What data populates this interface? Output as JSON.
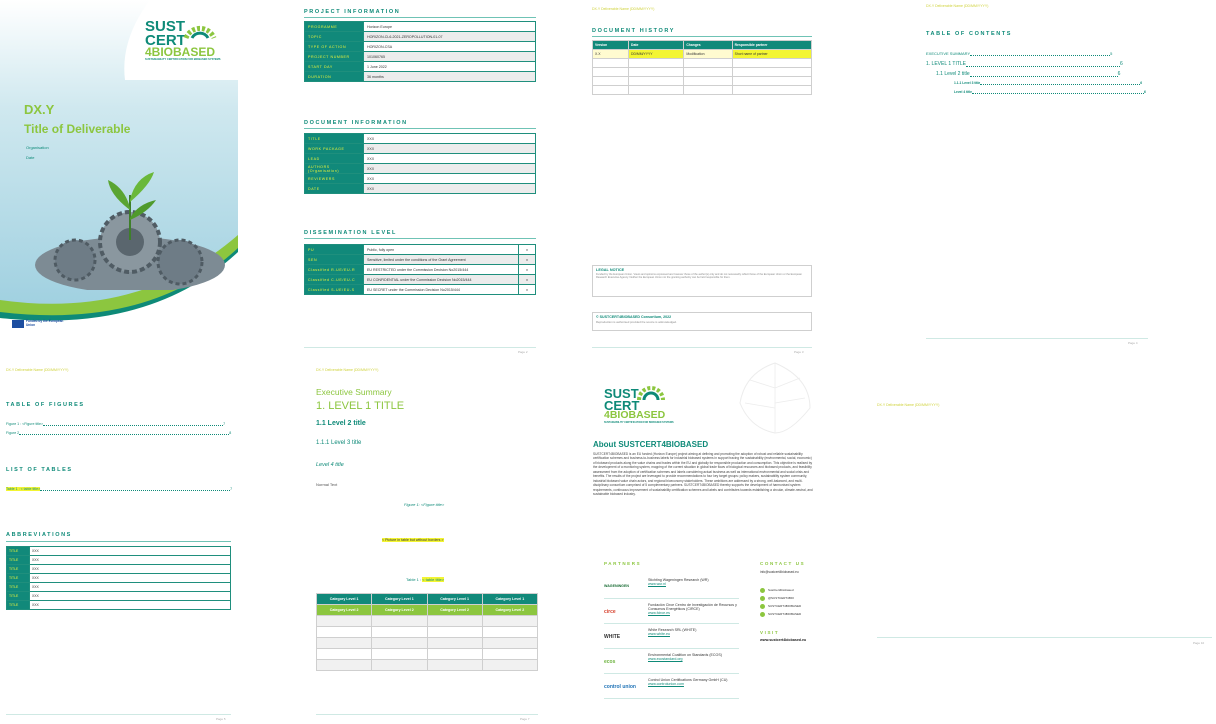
{
  "cover": {
    "brand_line1": "SUST",
    "brand_line2": "CERT",
    "brand_line3": "4BIOBASED",
    "brand_sub": "SUSTAINABILITY CERTIFICATION FOR BIOBASED SYSTEMS",
    "dx": "DX.Y",
    "title": "Title of Deliverable",
    "organisation": "Organisation",
    "date": "Date",
    "eu_funded": "Funded by the European Union"
  },
  "project_info": {
    "heading": "PROJECT INFORMATION",
    "rows": [
      {
        "k": "PROGRAMME",
        "v": "Horizon Europe"
      },
      {
        "k": "TOPIC",
        "v": "HORIZON-CL6-2021-ZEROPOLLUTION-01-07"
      },
      {
        "k": "TYPE OF ACTION",
        "v": "HORIZON-CSA"
      },
      {
        "k": "PROJECT NUMBER",
        "v": "101060765"
      },
      {
        "k": "START DAY",
        "v": "1 June 2022"
      },
      {
        "k": "DURATION",
        "v": "36 months"
      }
    ]
  },
  "doc_info": {
    "heading": "DOCUMENT INFORMATION",
    "rows": [
      {
        "k": "TITLE",
        "v": "XXX"
      },
      {
        "k": "WORK PACKAGE",
        "v": "XXX"
      },
      {
        "k": "LEAD",
        "v": "XXX"
      },
      {
        "k": "AUTHORS (Organisation)",
        "v": "XXX"
      },
      {
        "k": "REVIEWERS",
        "v": "XXX"
      },
      {
        "k": "DATE",
        "v": "XXX"
      }
    ]
  },
  "dissemination": {
    "heading": "DISSEMINATION LEVEL",
    "rows": [
      {
        "k": "PU",
        "v": "Public, fully open",
        "x": "x"
      },
      {
        "k": "SEN",
        "v": "Sensitive, limited under the conditions of the Grant Agreement",
        "x": "x"
      },
      {
        "k": "Classified R-UE/EU-R",
        "v": "EU RESTRICTED under the Commission Decision No2015/444",
        "x": "x"
      },
      {
        "k": "Classified C-UE/EU-C",
        "v": "EU CONFIDENTIAL under the Commission Decision No2015/444",
        "x": "x"
      },
      {
        "k": "Classified S-UE/EU-S",
        "v": "EU SECRET under the Commission Decision No2015/444",
        "x": "x"
      }
    ]
  },
  "running_header": "DX.Y Deliverable Name (DD/MM/YYYY)",
  "history": {
    "heading": "DOCUMENT HISTORY",
    "cols": [
      "Version",
      "Date",
      "Changes",
      "Responsible partner"
    ],
    "first_row": [
      "X.X",
      "DD/MM/YYYY",
      "Modification",
      "Short name of partner"
    ],
    "legal_title": "LEGAL NOTICE",
    "legal_text": "Funded by the European Union. Views and opinions expressed are however those of the author(s) only and do not necessarily reflect those of the European Union or the European Research Executive Agency. Neither the European Union nor the granting authority can be held responsible for them.",
    "copyright_title": "© SUSTCERT4BIOBASED Consortium, 2022",
    "copyright_text": "Reproduction is authorised provided the source is acknowledged."
  },
  "toc": {
    "heading": "TABLE OF CONTENTS",
    "entries": [
      {
        "t": "EXECUTIVE SUMMARY",
        "p": "5"
      },
      {
        "t": "1.    LEVEL 1 TITLE",
        "p": "6"
      },
      {
        "t": "1.1    Level 2 title",
        "p": "6"
      },
      {
        "t": "1.1.1  Level 3 title",
        "p": "6"
      },
      {
        "t": "Level 4 title",
        "p": "6"
      }
    ]
  },
  "figures": {
    "heading": "TABLE OF FIGURES",
    "items": [
      {
        "t": "Figure 1 : <Figure title>",
        "p": "7"
      },
      {
        "t": "Figure 2",
        "p": "8"
      }
    ],
    "tables_heading": "LIST OF TABLES",
    "table_item": "Table 1 : < table title>",
    "table_page": "7",
    "abbr_heading": "ABBREVIATIONS",
    "abbr_key": "TITLE",
    "abbr_val": "XXX"
  },
  "exec": {
    "summary": "Executive Summary",
    "level1": "1.   LEVEL 1 TITLE",
    "level2": "1.1   Level 2 title",
    "level3": "1.1.1   Level 3 title",
    "level4": "Level 4 title",
    "normal": "Normal Text",
    "figure_caption": "Figure 1: <Figure title>",
    "picture_note": "< Picture in table but without borders >",
    "table_caption_pre": "Table 1 : ",
    "table_caption_hl": "< table title>",
    "cat1": "Category Level 1",
    "cat2": "Category Level 2"
  },
  "about": {
    "title": "About SUSTCERT4BIOBASED",
    "body": "SUSTCERT4BIOBASED is an EU funded (Horizon Europe) project aiming at defining and promoting the adoption of robust and reliable sustainability certification schemes and business-to-business labels for industrial biobased systems in support tracing the sustainability (environmental, social, economic) of biobased products along the value chains and trades within the EU and globally for responsible production and consumption. This objective is realised by the development of a monitoring system, mapping of the current situation in global trade flows of biological resources and biobased products, and feasibility assessment from the adoption of certification schemes and labels considering actual business as well as international environmental and social crisis and benefits. The results of the project are leveraged to provide recommendations to four key target groups: policy makers, sustainability system community, industrial biobased value chain actors, and regional bioeconomy stakeholders. These ambitions are addressed by a strong, well-balanced, and multi-disciplinary consortium comprised of 5 complementary partners. SUSTCERT4BIOBASED thereby supports the development of harmonised system requirements, continuous improvement of sustainability certification schemes and labels and contributes towards establishing a circular, climate-neutral, and sustainable biobased industry.",
    "partners_heading": "PARTNERS",
    "contact_heading": "CONTACT US",
    "contact_email": "info@sustcert4biobased.eu",
    "socials": [
      "SustCert4biobased",
      "@SUSTCERT4BIO",
      "SUSTCERT4BIOBASED",
      "SUSTCERT4BIOBASED"
    ],
    "visit_heading": "VISIT",
    "visit_url": "www.sustcert4biobased.eu",
    "partners": [
      {
        "logo": "WAGENINGEN",
        "name": "Stichting Wageningen Research (WR)",
        "url": "www.wur.nl"
      },
      {
        "logo": "circe",
        "name": "Fundación Circe Centro de Investigación de Recursos y Consumos Energéticos (CIRCE)",
        "url": "www.fcirce.es"
      },
      {
        "logo": "WHITE",
        "name": "White Research SRL (WHITE)",
        "url": "www.white.eu"
      },
      {
        "logo": "ecos",
        "name": "Environmental Coalition on Standards (ECOS)",
        "url": "www.ecostandard.org"
      },
      {
        "logo": "control union",
        "name": "Control Union Certifications Germany GmbH (CU)",
        "url": "www.controlunion.com"
      }
    ]
  },
  "page_numbers": {
    "p1": "Page 2",
    "p2": "Page 3",
    "p3": "Page 4",
    "p4": "Page 5",
    "p5": "Page 7",
    "p6": "Page 8",
    "p7": "Page 10"
  }
}
